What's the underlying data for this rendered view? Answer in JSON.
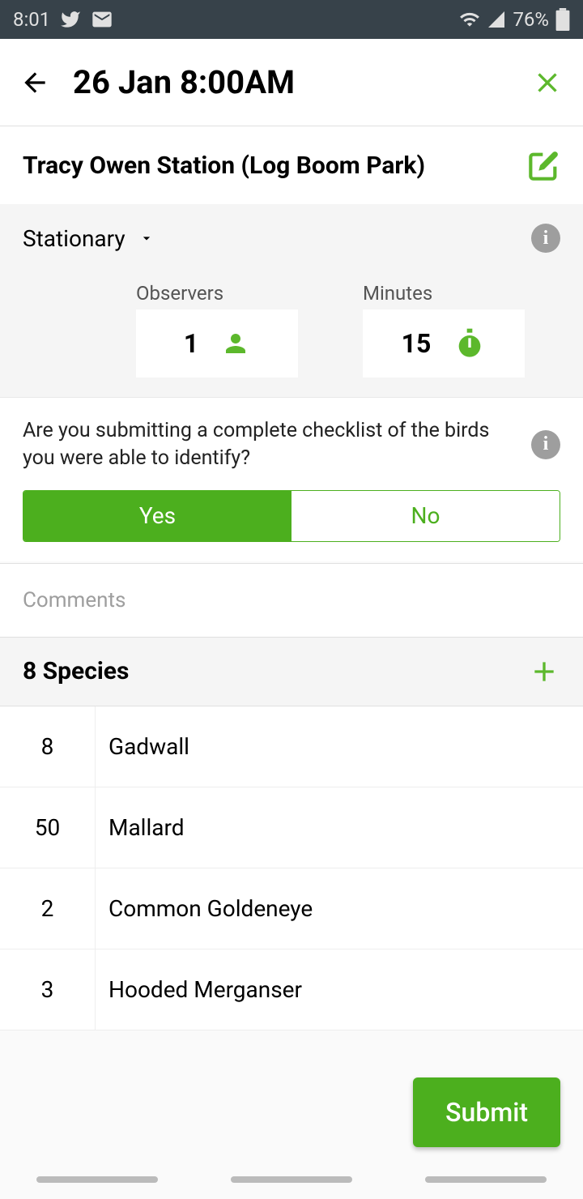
{
  "status": {
    "time": "8:01",
    "battery": "76%"
  },
  "header": {
    "title": "26 Jan 8:00AM"
  },
  "location": {
    "name": "Tracy Owen Station (Log Boom Park)"
  },
  "protocol": {
    "type": "Stationary"
  },
  "stats": {
    "observers_label": "Observers",
    "observers_value": "1",
    "minutes_label": "Minutes",
    "minutes_value": "15"
  },
  "question": {
    "text": "Are you submitting a complete checklist of the birds you were able to identify?",
    "yes": "Yes",
    "no": "No"
  },
  "comments_label": "Comments",
  "species_header": "8 Species",
  "species": [
    {
      "count": "8",
      "name": "Gadwall"
    },
    {
      "count": "50",
      "name": "Mallard"
    },
    {
      "count": "2",
      "name": "Common Goldeneye"
    },
    {
      "count": "3",
      "name": "Hooded Merganser"
    }
  ],
  "submit_label": "Submit"
}
